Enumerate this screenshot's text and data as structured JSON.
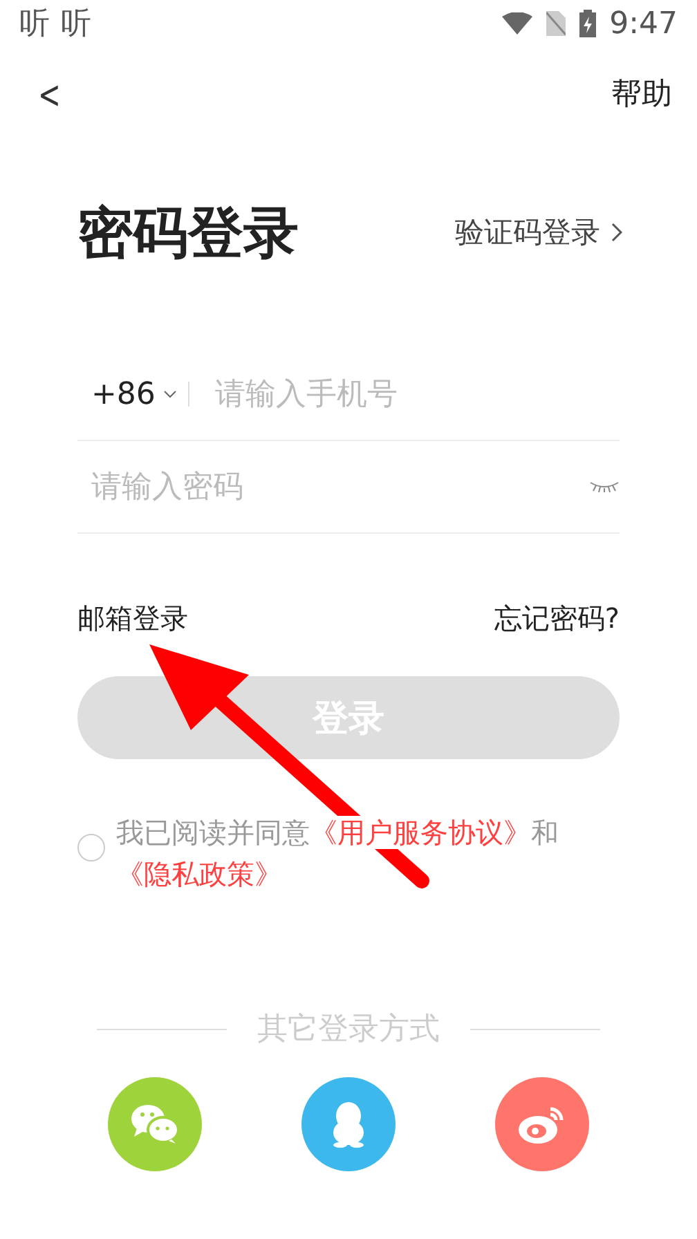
{
  "status_bar": {
    "app_labels": [
      "听",
      "听"
    ],
    "time": "9:47"
  },
  "header": {
    "back": "<",
    "help": "帮助"
  },
  "title": "密码登录",
  "switch_link": "验证码登录",
  "phone": {
    "country_code": "+86",
    "placeholder": "请输入手机号"
  },
  "password": {
    "placeholder": "请输入密码"
  },
  "email_link": "邮箱登录",
  "forgot_link": "忘记密码?",
  "login_button": {
    "label": "登录",
    "disabled": true
  },
  "agreement": {
    "checked": false,
    "prefix": "我已阅读并同意",
    "terms": "《用户服务协议》",
    "joiner": "和",
    "privacy": "《隐私政策》"
  },
  "other_title": "其它登录方式",
  "social": [
    {
      "kind": "chat",
      "color": "#9ed33b"
    },
    {
      "kind": "penguin",
      "color": "#3db8ec"
    },
    {
      "kind": "eye",
      "color": "#ff756b"
    }
  ],
  "annotation": {
    "kind": "arrow"
  }
}
